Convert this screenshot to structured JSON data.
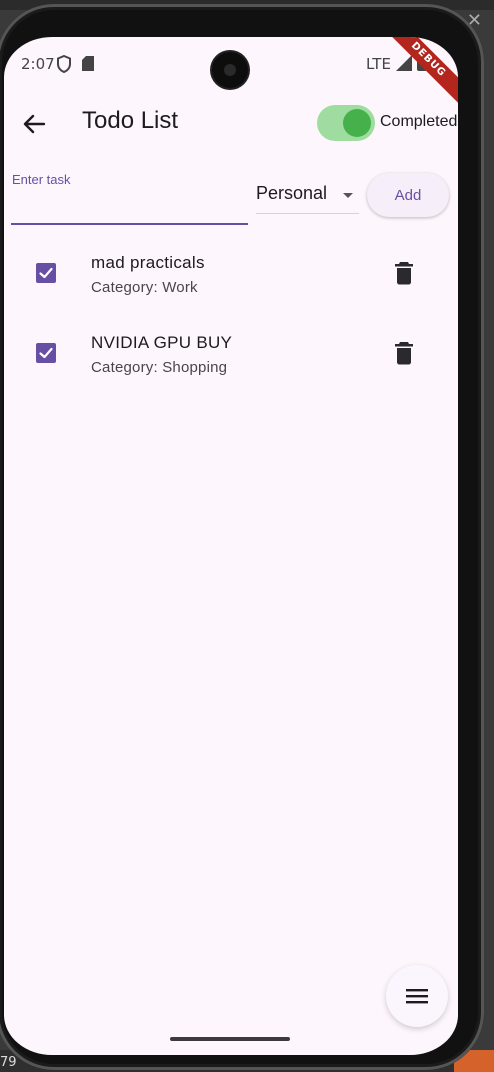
{
  "desktop": {
    "left_number": "79"
  },
  "status_bar": {
    "time": "2:07",
    "network": "LTE"
  },
  "debug_banner": "DEBUG",
  "app_bar": {
    "title": "Todo List",
    "toggle_label": "Completed",
    "toggle_on": true
  },
  "input_row": {
    "task_label": "Enter task",
    "task_value": "",
    "category_selected": "Personal",
    "add_label": "Add"
  },
  "todos": [
    {
      "title": "mad practicals",
      "category": "Category: Work",
      "completed": true
    },
    {
      "title": "NVIDIA GPU BUY",
      "category": "Category: Shopping",
      "completed": true
    }
  ],
  "colors": {
    "accent": "#6750a4",
    "background": "#fdf6fc",
    "toggle_track": "#9fdc9f",
    "toggle_knob": "#46b14a"
  }
}
